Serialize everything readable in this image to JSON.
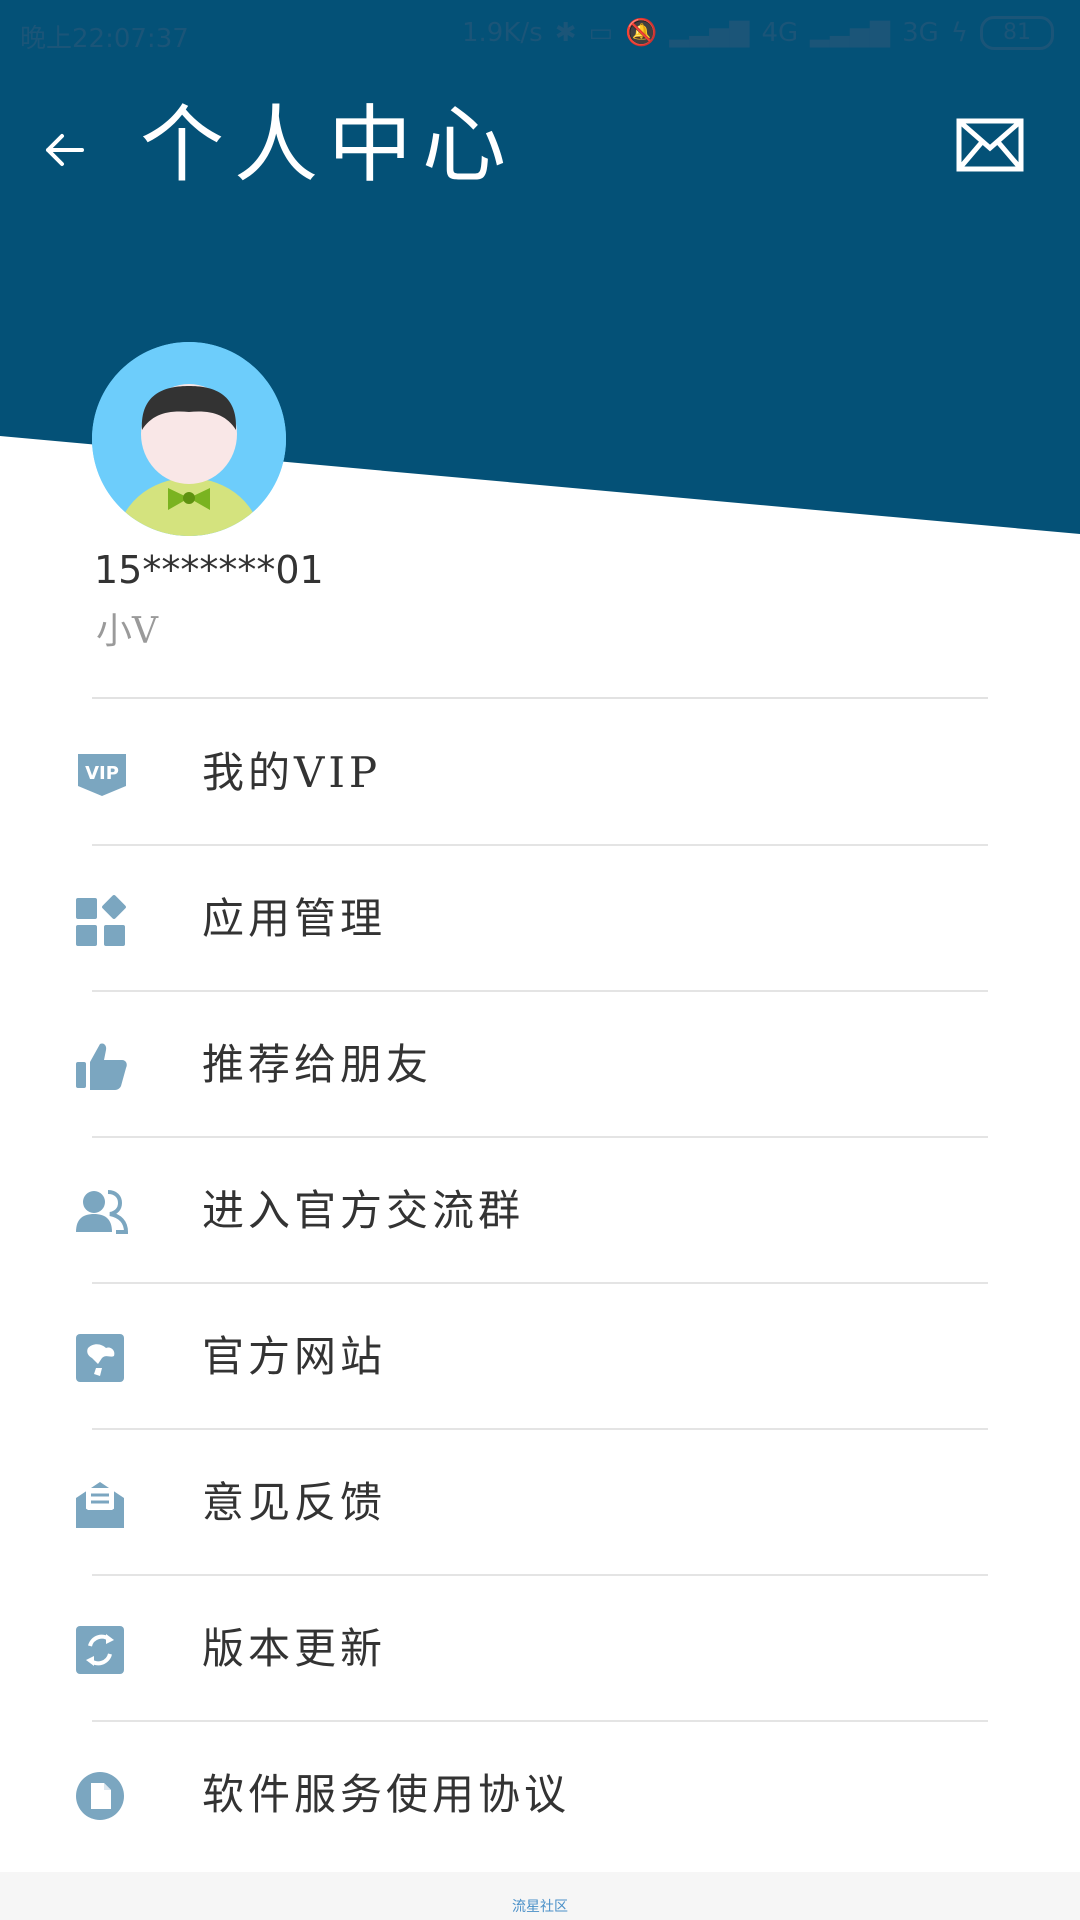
{
  "status_bar": {
    "time": "晚上22:07:37",
    "net_speed": "1.9K/s",
    "signal1": "4G",
    "signal2": "3G",
    "battery": "81"
  },
  "header": {
    "title": "个人中心",
    "bg_color": "#045177"
  },
  "profile": {
    "phone": "15*******01",
    "nickname": "小V"
  },
  "menu": [
    {
      "label": "我的VIP",
      "icon": "vip-icon"
    },
    {
      "label": "应用管理",
      "icon": "apps-icon"
    },
    {
      "label": "推荐给朋友",
      "icon": "thumbs-up-icon"
    },
    {
      "label": "进入官方交流群",
      "icon": "group-icon"
    },
    {
      "label": "官方网站",
      "icon": "website-icon"
    },
    {
      "label": "意见反馈",
      "icon": "feedback-icon"
    },
    {
      "label": "版本更新",
      "icon": "update-icon"
    },
    {
      "label": "软件服务使用协议",
      "icon": "document-icon"
    }
  ],
  "footer": {
    "text": "流星社区"
  },
  "colors": {
    "icon": "#7ba6c0",
    "accent": "#045177"
  }
}
